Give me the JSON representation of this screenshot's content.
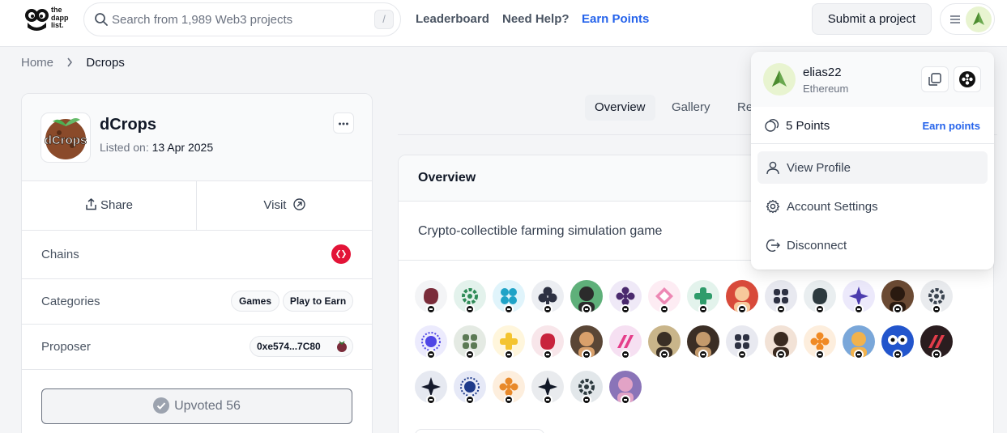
{
  "header": {
    "logo_text": [
      "the",
      "dapp",
      "list."
    ],
    "search_placeholder": "Search from 1,989 Web3 projects",
    "search_shortcut": "/",
    "nav": [
      {
        "label": "Leaderboard"
      },
      {
        "label": "Need Help?"
      },
      {
        "label": "Earn Points"
      }
    ],
    "submit_label": "Submit a project"
  },
  "breadcrumb": {
    "home": "Home",
    "current": "Dcrops"
  },
  "project": {
    "name": "dCrops",
    "listed_label": "Listed on:",
    "listed_date": "13 Apr 2025",
    "logo_text": "dCrops",
    "share_label": "Share",
    "visit_label": "Visit",
    "chains_label": "Chains",
    "categories_label": "Categories",
    "categories": [
      "Games",
      "Play to Earn"
    ],
    "proposer_label": "Proposer",
    "proposer_address": "0xe574...7C80",
    "upvote_label": "Upvoted 56"
  },
  "tabs": [
    {
      "label": "Overview"
    },
    {
      "label": "Gallery"
    },
    {
      "label": "Re"
    }
  ],
  "overview": {
    "title": "Overview",
    "description": "Crypto-collectible farming simulation game"
  },
  "dropdown": {
    "username": "elias22",
    "network": "Ethereum",
    "points": "5 Points",
    "earn_points": "Earn points",
    "items": [
      {
        "label": "View Profile",
        "icon": "user-icon"
      },
      {
        "label": "Account Settings",
        "icon": "gear-icon"
      },
      {
        "label": "Disconnect",
        "icon": "logout-icon"
      }
    ]
  },
  "colors": {
    "accent": "#2563eb",
    "hive_red": "#e31337"
  }
}
